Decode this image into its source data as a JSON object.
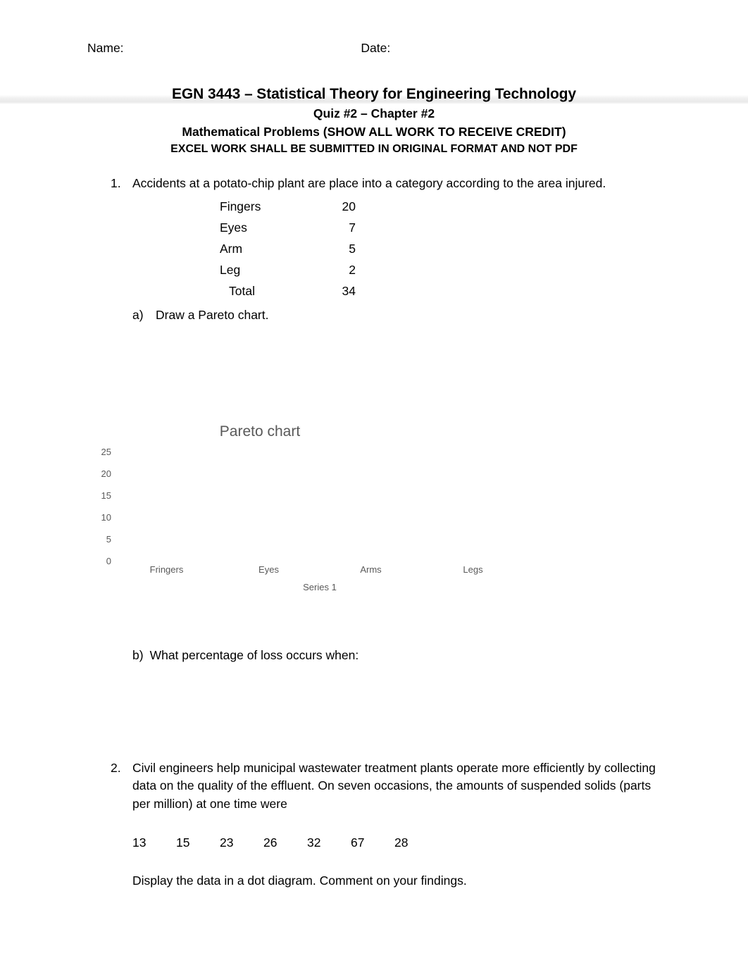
{
  "header": {
    "name_label": "Name:",
    "date_label": "Date:"
  },
  "title": {
    "line1": "EGN 3443 – Statistical Theory for Engineering Technology",
    "line2": "Quiz #2 – Chapter #2",
    "line3": "Mathematical Problems (SHOW ALL WORK TO RECEIVE CREDIT)",
    "line4": "EXCEL WORK SHALL BE SUBMITTED IN ORIGINAL FORMAT AND NOT PDF"
  },
  "question1": {
    "marker": "1.",
    "prompt": "Accidents at a potato-chip plant are place into a category according to the area injured.",
    "table": {
      "rows": [
        {
          "label": "Fingers",
          "value": "20"
        },
        {
          "label": "Eyes",
          "value": "7"
        },
        {
          "label": "Arm",
          "value": "5"
        },
        {
          "label": "Leg",
          "value": "2"
        }
      ],
      "total": {
        "label": "Total",
        "value": "34"
      }
    },
    "part_a": {
      "marker": "a)",
      "text": "Draw a Pareto chart."
    },
    "part_b": {
      "marker": "b)",
      "text": "What percentage of loss occurs when:"
    }
  },
  "chart_data": {
    "type": "bar",
    "title": "Pareto chart",
    "categories": [
      "Fringers",
      "Eyes",
      "Arms",
      "Legs"
    ],
    "series": [
      {
        "name": "Series 1",
        "values": []
      }
    ],
    "values": [],
    "xlabel": "",
    "ylabel": "",
    "ylim": [
      0,
      25
    ],
    "yticks": [
      "25",
      "20",
      "15",
      "10",
      "5",
      "0"
    ],
    "grid": false,
    "legend_position": "bottom",
    "legend_entries": [
      "Series 1"
    ],
    "note": "Plot area is empty; no bars are rendered in the screenshot."
  },
  "question2": {
    "marker": "2.",
    "prompt": "Civil engineers help municipal wastewater treatment plants operate more efficiently by collecting data on the quality of the effluent.  On seven occasions, the amounts of suspended solids (parts per million) at one time were",
    "values": [
      "13",
      "15",
      "23",
      "26",
      "32",
      "67",
      "28"
    ],
    "footer": "Display the data in a dot diagram.  Comment on your findings."
  }
}
